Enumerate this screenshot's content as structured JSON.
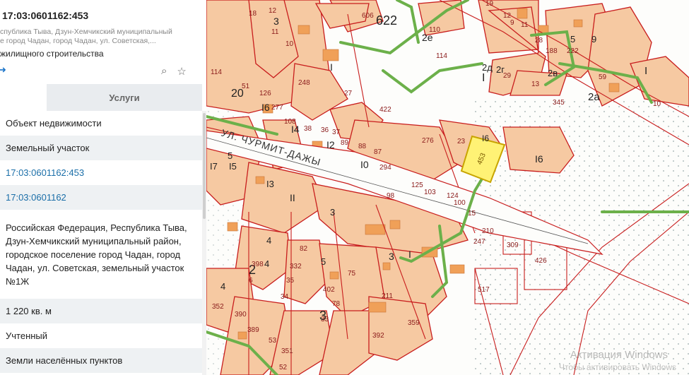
{
  "header": {
    "cadastral_number": "17:03:0601162:453",
    "address_snippet": "спублика Тыва, Дзун-Хемчикский муниципальный\nе город Чадан, город Чадан, ул. Советская,...",
    "land_use": "жилищного строительства"
  },
  "tabs": [
    {
      "label": ""
    },
    {
      "label": "Услуги"
    }
  ],
  "rows": [
    {
      "value": "Объект недвижимости"
    },
    {
      "value": "Земельный участок"
    },
    {
      "value": "17:03:0601162:453"
    },
    {
      "value": "17:03:0601162"
    },
    {
      "value": "Российская Федерация, Республика Тыва, Дзун-Хемчикский муниципальный район, городское поселение город Чадан, город Чадан, ул. Советская, земельный участок №1Ж"
    },
    {
      "value": "1 220 кв. м"
    },
    {
      "value": "Учтенный"
    },
    {
      "value": "Земли населённых пунктов"
    }
  ],
  "map": {
    "street_label": "УЛ. ЧУРМИТ-ДАЖЫ",
    "selected_parcel": "453",
    "quarter_labels": [
      "622",
      "2е",
      "2д",
      "2г",
      "2в",
      "2а",
      "I",
      "I6",
      "I5",
      "I7",
      "I3",
      "II",
      "20",
      "I6",
      "I4",
      "I2",
      "I0",
      "I",
      "3",
      "2",
      "3",
      "4",
      "4",
      "5",
      "3",
      "I",
      "I",
      "4",
      "5",
      "9",
      "3",
      "5",
      "I6"
    ],
    "parcel_labels": [
      "18",
      "12",
      "11",
      "606",
      "10",
      "110",
      "114",
      "19",
      "12",
      "11",
      "9",
      "28",
      "188",
      "222",
      "59",
      "51",
      "126",
      "277",
      "114",
      "248",
      "27",
      "422",
      "29",
      "13",
      "345",
      "10",
      "108",
      "38",
      "36",
      "37",
      "89",
      "88",
      "87",
      "276",
      "23",
      "294",
      "125",
      "103",
      "124",
      "98",
      "100",
      "15",
      "210",
      "247",
      "309",
      "426",
      "82",
      "332",
      "398",
      "6",
      "35",
      "34",
      "75",
      "402",
      "78",
      "33",
      "211",
      "359",
      "517",
      "392",
      "390",
      "389",
      "53",
      "351",
      "352",
      "52"
    ],
    "colors": {
      "parcel_fill": "#f6c9a2",
      "building": "#f0a058",
      "border": "#c81d1d",
      "road": "#6cb04a",
      "selected": "#fff275"
    }
  },
  "watermark": {
    "line1": "Активация Windows",
    "line2": "Чтобы активировать Windows"
  }
}
